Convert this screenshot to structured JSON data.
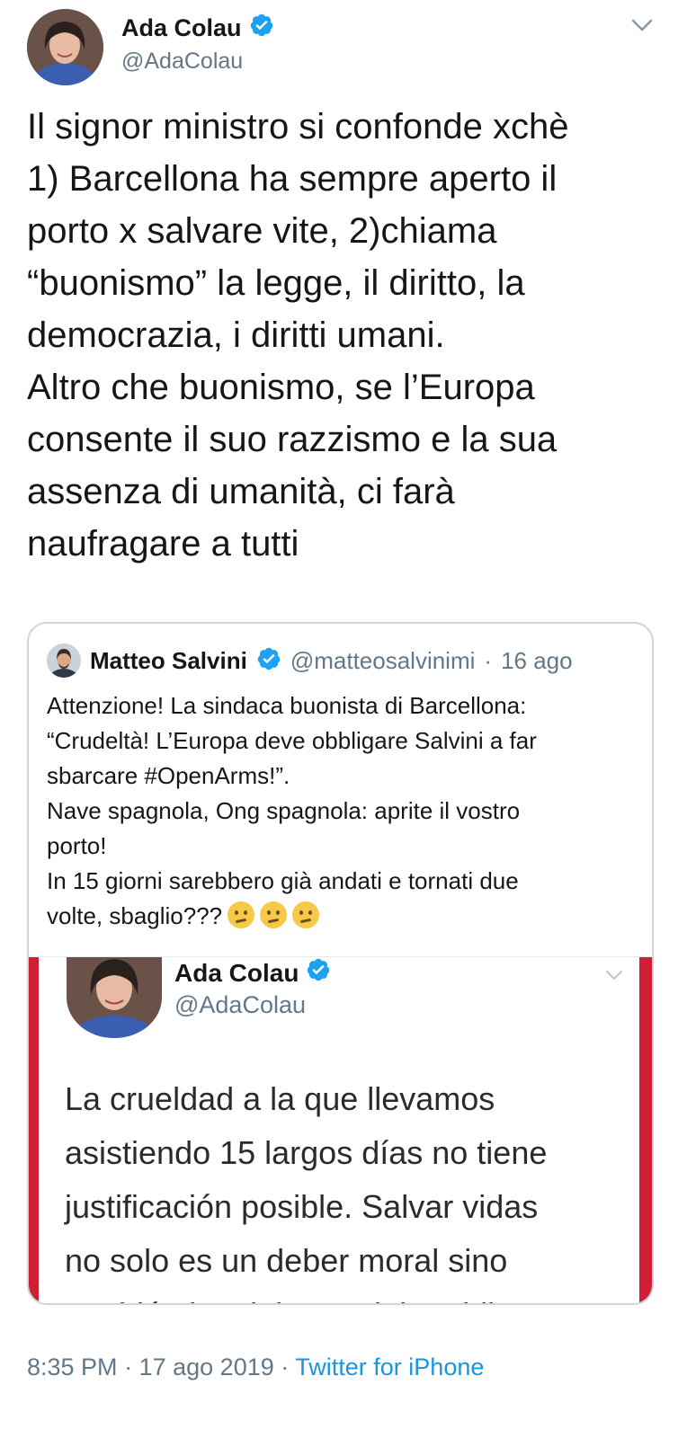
{
  "author": {
    "name": "Ada Colau",
    "handle": "@AdaColau",
    "verified": true,
    "verified_icon": "verified-badge-icon"
  },
  "tweet": {
    "text": "Il signor ministro si confonde xchè\n1) Barcellona ha sempre aperto il\nporto x salvare vite, 2)chiama\n“buonismo” la legge, il diritto, la\ndemocrazia, i diritti umani.\nAltro che buonismo, se l’Europa\nconsente il suo razzismo e la sua\nassenza di umanità, ci farà\nnaufragare a tutti"
  },
  "quoted": {
    "name": "Matteo Salvini",
    "handle": "@matteosalvinimi",
    "date": "16 ago",
    "separator": "·",
    "text": "Attenzione! La sindaca buonista di Barcellona:\n“Crudeltà! L’Europa deve obbligare Salvini a far\nsbarcare #OpenArms!”.\nNave spagnola, Ong spagnola: aprite il vostro\nporto!\nIn 15 giorni sarebbero già andati e tornati due\nvolte, sbaglio???",
    "emojis": [
      "thinking-face-icon",
      "thinking-face-icon",
      "thinking-face-icon"
    ],
    "embedded": {
      "name": "Ada Colau",
      "handle": "@AdaColau",
      "text": "La crueldad a la que llevamos\nasistiendo 15 largos días no tiene\njustificación posible. Salvar vidas\nno solo es un deber moral sino\ntambién legal: la UE debe obligar a"
    }
  },
  "footer": {
    "time": "8:35 PM",
    "date": "17 ago 2019",
    "separator": "·",
    "source": "Twitter for iPhone"
  },
  "colors": {
    "accent": "#1da1f2",
    "muted": "#657786",
    "link": "#1b95e0",
    "embed_border": "#d01f34"
  }
}
